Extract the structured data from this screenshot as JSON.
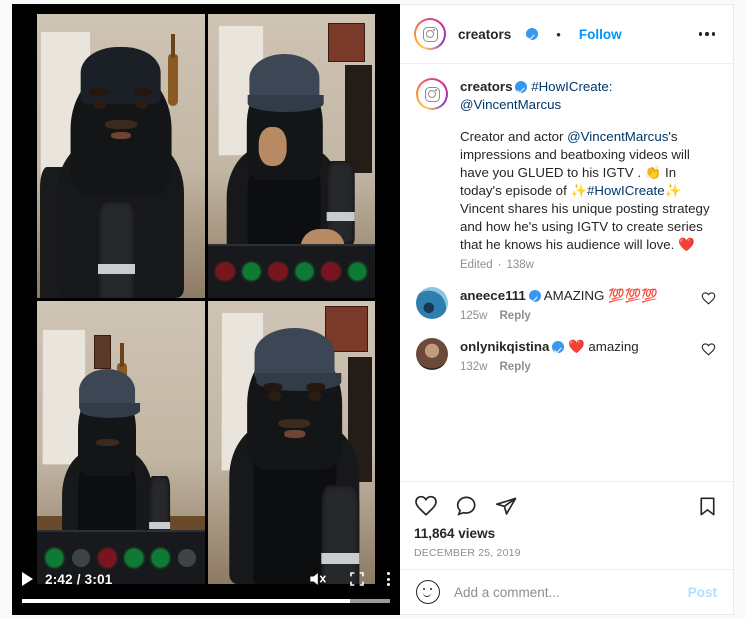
{
  "post": {
    "header": {
      "username": "creators",
      "verified": true,
      "separator": "•",
      "follow_label": "Follow",
      "options_icon": "more-horizontal-icon"
    },
    "caption": {
      "username": "creators",
      "verified": true,
      "title_hashtag": "#HowICreate:",
      "title_mention": "@VincentMarcus",
      "body_1": "Creator and actor ",
      "body_mention": "@VincentMarcus",
      "body_2": "'s impressions and beatboxing videos will have you GLUED to his IGTV . ",
      "emoji_clap": "👏",
      "body_3": "In today's episode of ",
      "emoji_sparkle_1": "✨",
      "body_hashtag": "#HowICreate",
      "emoji_sparkle_2": "✨",
      "body_4": " Vincent shares his unique posting strategy and how he's using IGTV to create series that he knows his audience will love. ",
      "emoji_heart": "❤️",
      "edited_label": "Edited",
      "edited_sep": "·",
      "age": "138w"
    },
    "comments": [
      {
        "username": "aneece111",
        "verified": true,
        "text": "AMAZING ",
        "emoji": "💯💯💯",
        "age": "125w",
        "reply_label": "Reply",
        "like_icon": "heart-icon",
        "avatar_colors": [
          "#2f7fae",
          "#8fc4dd",
          "#16384f"
        ]
      },
      {
        "username": "onlynikqistina",
        "verified": true,
        "text": "",
        "emoji": "❤️",
        "text_after": " amazing",
        "age": "132w",
        "reply_label": "Reply",
        "like_icon": "heart-icon",
        "avatar_colors": [
          "#6b4a3a",
          "#c49a7c",
          "#2b1a12"
        ]
      }
    ],
    "actions": {
      "like_icon": "heart-icon",
      "comment_icon": "comment-bubble-icon",
      "share_icon": "share-paper-plane-icon",
      "save_icon": "bookmark-icon"
    },
    "stats": {
      "views": "11,864 views",
      "date": "DECEMBER 25, 2019"
    },
    "add_comment": {
      "emoji_icon": "smiley-face-icon",
      "placeholder": "Add a comment...",
      "value": "",
      "post_label": "Post"
    }
  },
  "video": {
    "play_icon": "play-icon",
    "current_time": "2:42",
    "time_separator": "/",
    "duration": "3:01",
    "time_display": "2:42 / 3:01",
    "mute_icon": "volume-muted-icon",
    "fullscreen_icon": "fullscreen-icon",
    "menu_icon": "more-vertical-icon",
    "progress_percent": 89,
    "panels": 4
  },
  "colors": {
    "accent_blue": "#0095f6",
    "link_blue": "#00376b",
    "verified_blue": "#3897f0",
    "text": "#262626",
    "muted": "#8e8e8e",
    "post_disabled": "#b2dffc",
    "page_bg": "#fafafa"
  }
}
